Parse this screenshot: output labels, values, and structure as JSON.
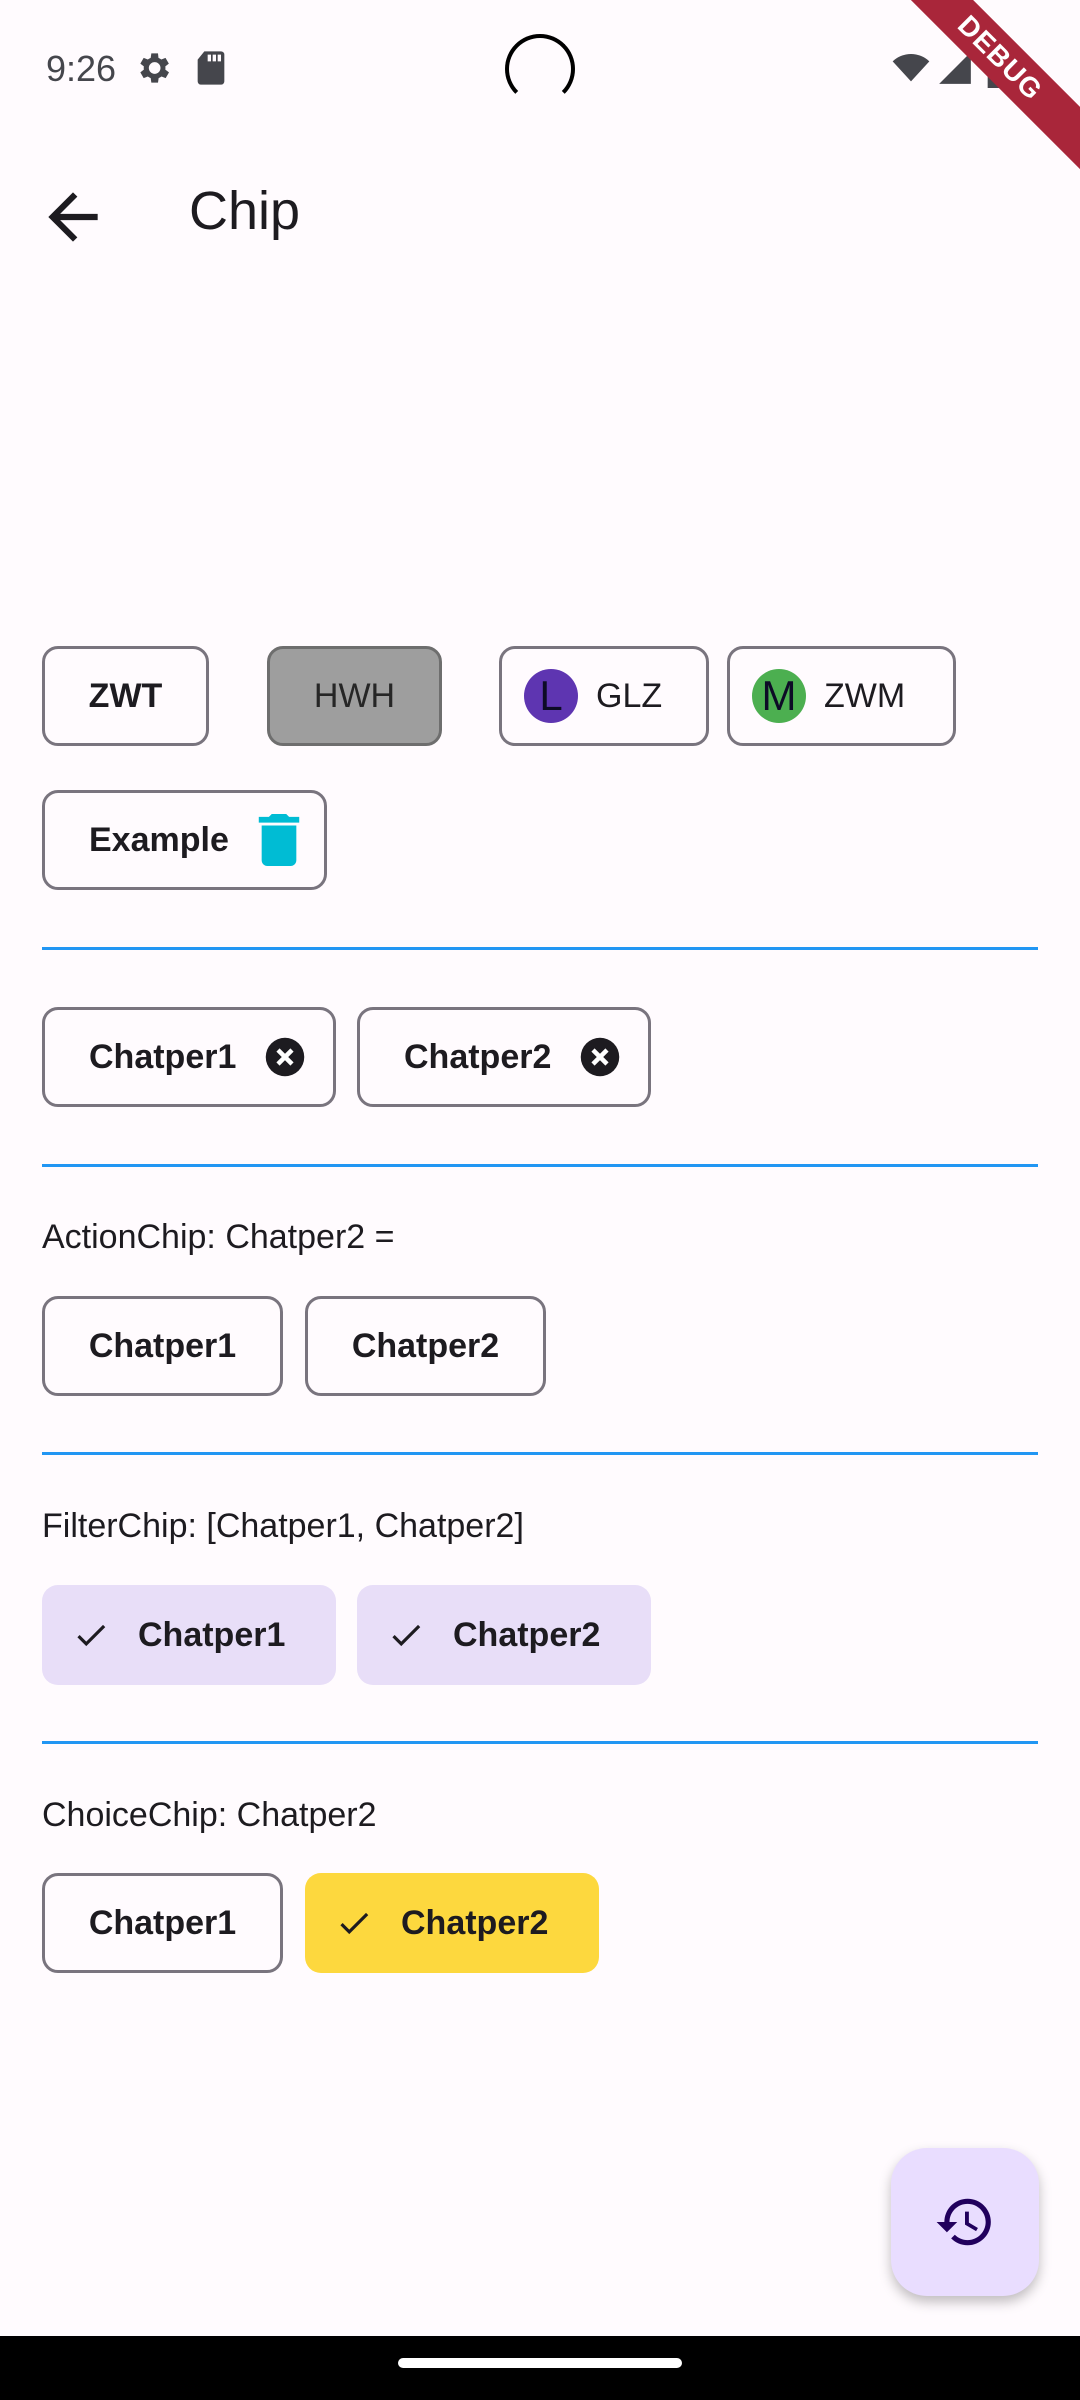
{
  "status_bar": {
    "time": "9:26",
    "debug_label": "DEBUG"
  },
  "appbar": {
    "title": "Chip"
  },
  "input_chips": {
    "row1": [
      {
        "label": "ZWT"
      },
      {
        "label": "HWH"
      },
      {
        "label": "GLZ",
        "avatar_letter": "L",
        "avatar_color": "#5e35b1"
      },
      {
        "label": "ZWM",
        "avatar_letter": "M",
        "avatar_color": "#4caf50"
      }
    ],
    "example": {
      "label": "Example",
      "delete_icon_color": "#00bcd4"
    }
  },
  "deletable_chips": [
    {
      "label": "Chatper1"
    },
    {
      "label": "Chatper2"
    }
  ],
  "action_chips": {
    "status": "ActionChip: Chatper2 =",
    "items": [
      {
        "label": "Chatper1"
      },
      {
        "label": "Chatper2"
      }
    ]
  },
  "filter_chips": {
    "status": "FilterChip: [Chatper1, Chatper2]",
    "items": [
      {
        "label": "Chatper1"
      },
      {
        "label": "Chatper2"
      }
    ]
  },
  "choice_chips": {
    "status": "ChoiceChip: Chatper2",
    "items": [
      {
        "label": "Chatper1"
      },
      {
        "label": "Chatper2"
      }
    ],
    "selected_color": "#fdd83e"
  },
  "fab": {
    "icon": "history-icon"
  },
  "colors": {
    "divider": "#2196f3",
    "filter_bg": "#e8def8",
    "fab_bg": "#e9ddff"
  }
}
